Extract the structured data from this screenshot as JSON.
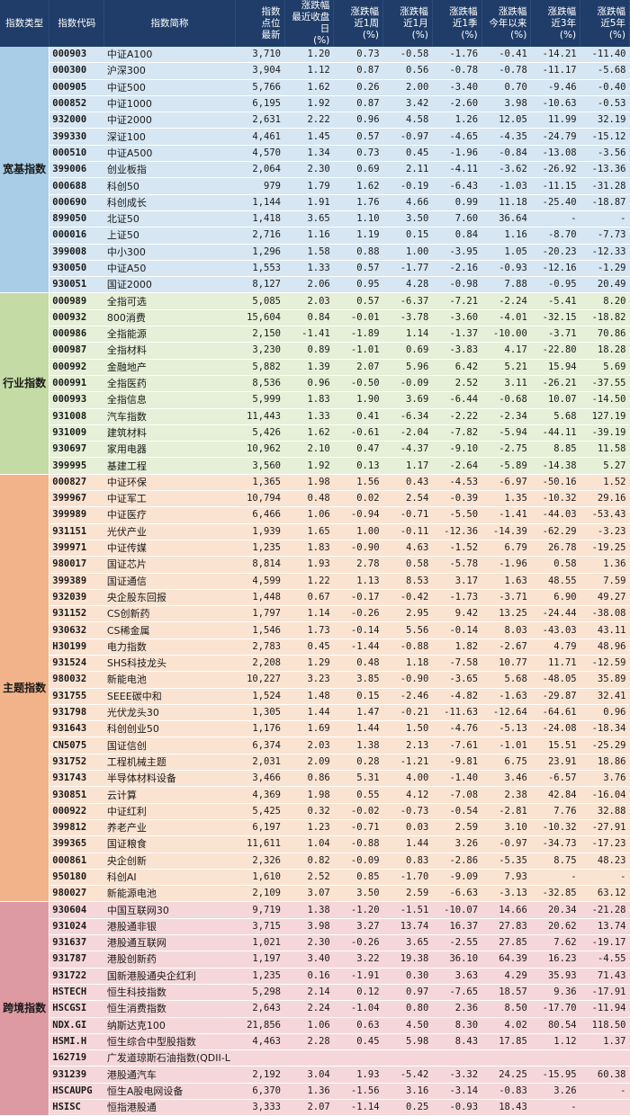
{
  "headers": {
    "category": "指数类型",
    "code": "指数代码",
    "name": "指数简称",
    "col1": [
      "指数",
      "点位",
      "最新"
    ],
    "col2": [
      "涨跌幅",
      "最近收盘日",
      "(%)"
    ],
    "col3": [
      "涨跌幅",
      "近1周",
      "(%)"
    ],
    "col4": [
      "涨跌幅",
      "近1月",
      "(%)"
    ],
    "col5": [
      "涨跌幅",
      "近1季",
      "(%)"
    ],
    "col6": [
      "涨跌幅",
      "今年以来",
      "(%)"
    ],
    "col7": [
      "涨跌幅",
      "近3年",
      "(%)"
    ],
    "col8": [
      "涨跌幅",
      "近5年",
      "(%)"
    ]
  },
  "groups": [
    {
      "name": "宽基指数",
      "rows": [
        [
          "000903",
          "中证A100",
          "3,710",
          "1.20",
          "0.73",
          "-0.58",
          "-1.76",
          "-0.41",
          "-14.21",
          "-11.40"
        ],
        [
          "000300",
          "沪深300",
          "3,904",
          "1.12",
          "0.87",
          "0.56",
          "-0.78",
          "-0.78",
          "-11.17",
          "-5.68"
        ],
        [
          "000905",
          "中证500",
          "5,766",
          "1.62",
          "0.26",
          "2.00",
          "-3.40",
          "0.70",
          "-9.46",
          "-0.40"
        ],
        [
          "000852",
          "中证1000",
          "6,195",
          "1.92",
          "0.87",
          "3.42",
          "-2.60",
          "3.98",
          "-10.63",
          "-0.53"
        ],
        [
          "932000",
          "中证2000",
          "2,631",
          "2.22",
          "0.96",
          "4.58",
          "1.26",
          "12.05",
          "11.99",
          "32.19"
        ],
        [
          "399330",
          "深证100",
          "4,461",
          "1.45",
          "0.57",
          "-0.97",
          "-4.65",
          "-4.35",
          "-24.79",
          "-15.12"
        ],
        [
          "000510",
          "中证A500",
          "4,570",
          "1.34",
          "0.73",
          "0.45",
          "-1.96",
          "-0.84",
          "-13.08",
          "-3.56"
        ],
        [
          "399006",
          "创业板指",
          "2,064",
          "2.30",
          "0.69",
          "2.11",
          "-4.11",
          "-3.62",
          "-26.92",
          "-13.36"
        ],
        [
          "000688",
          "科创50",
          "979",
          "1.79",
          "1.62",
          "-0.19",
          "-6.43",
          "-1.03",
          "-11.15",
          "-31.28"
        ],
        [
          "000690",
          "科创成长",
          "1,144",
          "1.91",
          "1.76",
          "4.66",
          "0.99",
          "11.18",
          "-25.40",
          "-18.87"
        ],
        [
          "899050",
          "北证50",
          "1,418",
          "3.65",
          "1.10",
          "3.50",
          "7.60",
          "36.64",
          "-",
          "-"
        ],
        [
          "000016",
          "上证50",
          "2,716",
          "1.16",
          "1.19",
          "0.15",
          "0.84",
          "1.16",
          "-8.70",
          "-7.73"
        ],
        [
          "399008",
          "中小300",
          "1,296",
          "1.58",
          "0.88",
          "1.00",
          "-3.95",
          "1.05",
          "-20.23",
          "-12.33"
        ],
        [
          "930050",
          "中证A50",
          "1,553",
          "1.33",
          "0.57",
          "-1.77",
          "-2.16",
          "-0.93",
          "-12.16",
          "-1.29"
        ],
        [
          "930051",
          "国证2000",
          "8,127",
          "2.06",
          "0.95",
          "4.28",
          "-0.98",
          "7.88",
          "-0.95",
          "20.49"
        ]
      ]
    },
    {
      "name": "行业指数",
      "rows": [
        [
          "000989",
          "全指可选",
          "5,085",
          "2.03",
          "0.57",
          "-6.37",
          "-7.21",
          "-2.24",
          "-5.41",
          "8.20"
        ],
        [
          "000932",
          "800消费",
          "15,604",
          "0.84",
          "-0.01",
          "-3.78",
          "-3.60",
          "-4.01",
          "-32.15",
          "-18.82"
        ],
        [
          "000986",
          "全指能源",
          "2,150",
          "-1.41",
          "-1.89",
          "1.14",
          "-1.37",
          "-10.00",
          "-3.71",
          "70.86"
        ],
        [
          "000987",
          "全指材料",
          "3,230",
          "0.89",
          "-1.01",
          "0.69",
          "-3.83",
          "4.17",
          "-22.80",
          "18.28"
        ],
        [
          "000992",
          "金融地产",
          "5,882",
          "1.39",
          "2.07",
          "5.96",
          "6.42",
          "5.21",
          "15.94",
          "5.69"
        ],
        [
          "000991",
          "全指医药",
          "8,536",
          "0.96",
          "-0.50",
          "-0.09",
          "2.52",
          "3.11",
          "-26.21",
          "-37.55"
        ],
        [
          "000993",
          "全指信息",
          "5,999",
          "1.83",
          "1.90",
          "3.69",
          "-6.44",
          "-0.68",
          "10.07",
          "-14.50"
        ],
        [
          "931008",
          "汽车指数",
          "11,443",
          "1.33",
          "0.41",
          "-6.34",
          "-2.22",
          "-2.34",
          "5.68",
          "127.19"
        ],
        [
          "931009",
          "建筑材料",
          "5,426",
          "1.62",
          "-0.61",
          "-2.04",
          "-7.82",
          "-5.94",
          "-44.11",
          "-39.19"
        ],
        [
          "930697",
          "家用电器",
          "10,962",
          "2.10",
          "0.47",
          "-4.37",
          "-9.10",
          "-2.75",
          "8.85",
          "11.58"
        ],
        [
          "399995",
          "基建工程",
          "3,560",
          "1.92",
          "0.13",
          "1.17",
          "-2.64",
          "-5.89",
          "-14.38",
          "5.27"
        ]
      ]
    },
    {
      "name": "主题指数",
      "rows": [
        [
          "000827",
          "中证环保",
          "1,365",
          "1.98",
          "1.56",
          "0.43",
          "-4.53",
          "-6.97",
          "-50.16",
          "1.52"
        ],
        [
          "399967",
          "中证军工",
          "10,794",
          "0.48",
          "0.02",
          "2.54",
          "-0.39",
          "1.35",
          "-10.32",
          "29.16"
        ],
        [
          "399989",
          "中证医疗",
          "6,466",
          "1.06",
          "-0.94",
          "-0.71",
          "-5.50",
          "-1.41",
          "-44.03",
          "-53.43"
        ],
        [
          "931151",
          "光伏产业",
          "1,939",
          "1.65",
          "1.00",
          "-0.11",
          "-12.36",
          "-14.39",
          "-62.29",
          "-3.23"
        ],
        [
          "399971",
          "中证传媒",
          "1,235",
          "1.83",
          "-0.90",
          "4.63",
          "-1.52",
          "6.79",
          "26.78",
          "-19.25"
        ],
        [
          "980017",
          "国证芯片",
          "8,814",
          "1.93",
          "2.78",
          "0.58",
          "-5.78",
          "-1.96",
          "0.58",
          "1.36"
        ],
        [
          "399389",
          "国证通信",
          "4,599",
          "1.22",
          "1.13",
          "8.53",
          "3.17",
          "1.63",
          "48.55",
          "7.59"
        ],
        [
          "932039",
          "央企股东回报",
          "1,448",
          "0.67",
          "-0.17",
          "-0.42",
          "-1.73",
          "-3.71",
          "6.90",
          "49.27"
        ],
        [
          "931152",
          "CS创新药",
          "1,797",
          "1.14",
          "-0.26",
          "2.95",
          "9.42",
          "13.25",
          "-24.44",
          "-38.08"
        ],
        [
          "930632",
          "CS稀金属",
          "1,546",
          "1.73",
          "-0.14",
          "5.56",
          "-0.14",
          "8.03",
          "-43.03",
          "43.11"
        ],
        [
          "H30199",
          "电力指数",
          "2,783",
          "0.45",
          "-1.44",
          "-0.88",
          "1.82",
          "-2.67",
          "4.79",
          "48.96"
        ],
        [
          "931524",
          "SHS科技龙头",
          "2,208",
          "1.29",
          "0.48",
          "1.18",
          "-7.58",
          "10.77",
          "11.71",
          "-12.59"
        ],
        [
          "980032",
          "新能电池",
          "10,227",
          "3.23",
          "3.85",
          "-0.90",
          "-3.65",
          "5.68",
          "-48.05",
          "35.89"
        ],
        [
          "931755",
          "SEEE碳中和",
          "1,524",
          "1.48",
          "0.15",
          "-2.46",
          "-4.82",
          "-1.63",
          "-29.87",
          "32.41"
        ],
        [
          "931798",
          "光伏龙头30",
          "1,305",
          "1.44",
          "1.47",
          "-0.21",
          "-11.63",
          "-12.64",
          "-64.61",
          "0.96"
        ],
        [
          "931643",
          "科创创业50",
          "1,176",
          "1.69",
          "1.44",
          "1.50",
          "-4.76",
          "-5.13",
          "-24.08",
          "-18.34"
        ],
        [
          "CN5075",
          "国证信创",
          "6,374",
          "2.03",
          "1.38",
          "2.13",
          "-7.61",
          "-1.01",
          "15.51",
          "-25.29"
        ],
        [
          "931752",
          "工程机械主题",
          "2,031",
          "2.09",
          "0.28",
          "-1.21",
          "-9.81",
          "6.75",
          "23.91",
          "18.86"
        ],
        [
          "931743",
          "半导体材料设备",
          "3,466",
          "0.86",
          "5.31",
          "4.00",
          "-1.40",
          "3.46",
          "-6.57",
          "3.76"
        ],
        [
          "930851",
          "云计算",
          "4,369",
          "1.98",
          "0.55",
          "4.12",
          "-7.08",
          "2.38",
          "42.84",
          "-16.04"
        ],
        [
          "000922",
          "中证红利",
          "5,425",
          "0.32",
          "-0.02",
          "-0.73",
          "-0.54",
          "-2.81",
          "7.76",
          "32.88"
        ],
        [
          "399812",
          "养老产业",
          "6,197",
          "1.23",
          "-0.71",
          "0.03",
          "2.59",
          "3.10",
          "-10.32",
          "-27.91"
        ],
        [
          "399365",
          "国证粮食",
          "11,611",
          "1.04",
          "-0.88",
          "1.44",
          "3.26",
          "-0.97",
          "-34.73",
          "-17.23"
        ],
        [
          "000861",
          "央企创新",
          "2,326",
          "0.82",
          "-0.09",
          "0.83",
          "-2.86",
          "-5.35",
          "8.75",
          "48.23"
        ],
        [
          "950180",
          "科创AI",
          "1,610",
          "2.52",
          "0.85",
          "-1.70",
          "-9.09",
          "7.93",
          "-",
          "-"
        ],
        [
          "980027",
          "新能源电池",
          "2,109",
          "3.07",
          "3.50",
          "2.59",
          "-6.63",
          "-3.13",
          "-32.85",
          "63.12"
        ]
      ]
    },
    {
      "name": "跨境指数",
      "rows": [
        [
          "930604",
          "中国互联网30",
          "9,719",
          "1.38",
          "-1.20",
          "-1.51",
          "-10.07",
          "14.66",
          "20.34",
          "-21.28"
        ],
        [
          "931024",
          "港股通非银",
          "3,715",
          "3.98",
          "3.27",
          "13.74",
          "16.37",
          "27.83",
          "20.62",
          "13.74"
        ],
        [
          "931637",
          "港股通互联网",
          "1,021",
          "2.30",
          "-0.26",
          "3.65",
          "-2.55",
          "27.85",
          "7.62",
          "-19.17"
        ],
        [
          "931787",
          "港股创新药",
          "1,197",
          "3.40",
          "3.22",
          "19.38",
          "36.10",
          "64.39",
          "16.23",
          "-4.55"
        ],
        [
          "931722",
          "国新港股通央企红利",
          "1,235",
          "0.16",
          "-1.91",
          "0.30",
          "3.63",
          "4.29",
          "35.93",
          "71.43"
        ],
        [
          "HSTECH",
          "恒生科技指数",
          "5,298",
          "2.14",
          "0.12",
          "0.97",
          "-7.65",
          "18.57",
          "9.36",
          "-17.91"
        ],
        [
          "HSCGSI",
          "恒生消费指数",
          "2,643",
          "2.24",
          "-1.04",
          "0.80",
          "2.36",
          "8.50",
          "-17.70",
          "-11.94"
        ],
        [
          "NDX.GI",
          "纳斯达克100",
          "21,856",
          "1.06",
          "0.63",
          "4.50",
          "8.30",
          "4.02",
          "80.54",
          "118.50"
        ],
        [
          "HSMI.H",
          "恒生综合中型股指数",
          "4,463",
          "2.28",
          "0.45",
          "5.98",
          "8.43",
          "17.85",
          "1.12",
          "1.37"
        ],
        [
          "162719",
          "广发道琼斯石油指数(QDII-L",
          "",
          "",
          "",
          "",
          "",
          "",
          "",
          ""
        ],
        [
          "931239",
          "港股通汽车",
          "2,192",
          "3.04",
          "1.93",
          "-5.42",
          "-3.32",
          "24.25",
          "-15.95",
          "60.38"
        ],
        [
          "HSCAUPG",
          "恒生A股电网设备",
          "6,370",
          "1.36",
          "-1.56",
          "3.16",
          "-3.14",
          "-0.83",
          "3.26",
          "-"
        ],
        [
          "HSISC",
          "恒指港股通",
          "3,333",
          "2.07",
          "-1.14",
          "0.25",
          "-0.93",
          "18.43",
          "-",
          ""
        ]
      ]
    }
  ]
}
